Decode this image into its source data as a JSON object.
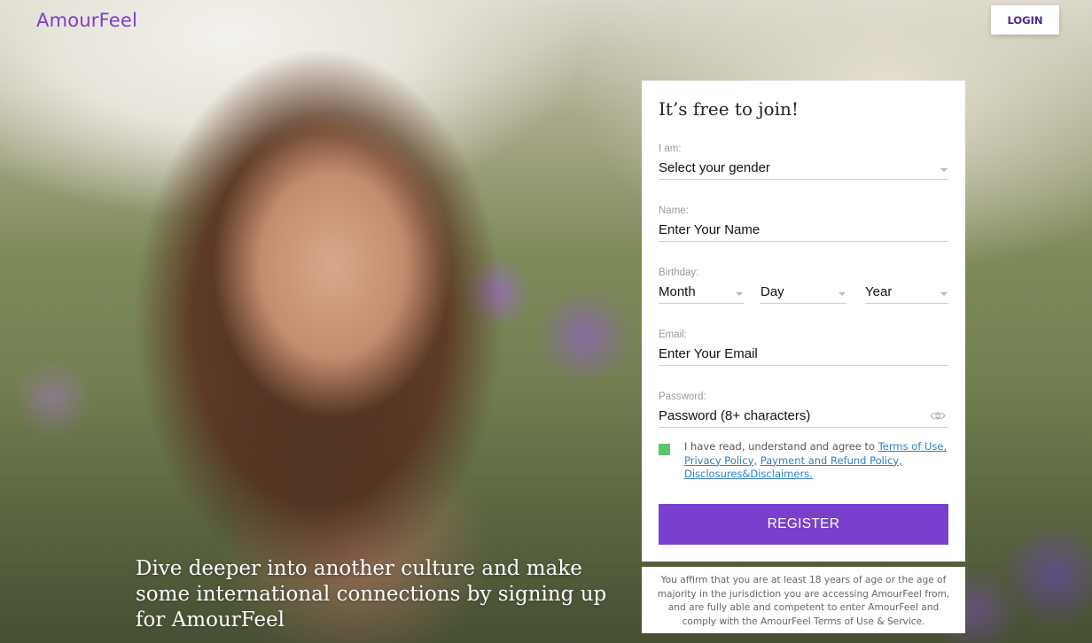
{
  "brand": {
    "name": "AmourFeel",
    "color": "#7b3fc8"
  },
  "header": {
    "login_label": "LOGIN"
  },
  "hero": {
    "tagline": "Dive deeper into another culture and make some international connections by signing up for AmourFeel"
  },
  "form": {
    "title": "It’s free to join!",
    "gender": {
      "label": "I am:",
      "value": "Select your gender"
    },
    "name": {
      "label": "Name:",
      "placeholder": "Enter Your Name"
    },
    "birthday": {
      "label": "Birthday:",
      "month": "Month",
      "day": "Day",
      "year": "Year"
    },
    "email": {
      "label": "Email:",
      "placeholder": "Enter Your Email"
    },
    "password": {
      "label": "Password:",
      "placeholder": "Password (8+ characters)"
    },
    "terms": {
      "checked": true,
      "prefix": "I have read, understand and agree to ",
      "link_terms": "Terms of Use,",
      "link_privacy": "Privacy Policy,",
      "link_payment": "Payment and Refund Policy,",
      "link_disclosures": "Disclosures&Disclaimers."
    },
    "register_label": "REGISTER",
    "register_color": "#7a3fcc"
  },
  "disclaimer": "You affirm that you are at least 18 years of age or the age of majority in the jurisdiction you are accessing AmourFeel from, and are fully able and competent to enter AmourFeel and comply with the AmourFeel Terms of Use & Service."
}
